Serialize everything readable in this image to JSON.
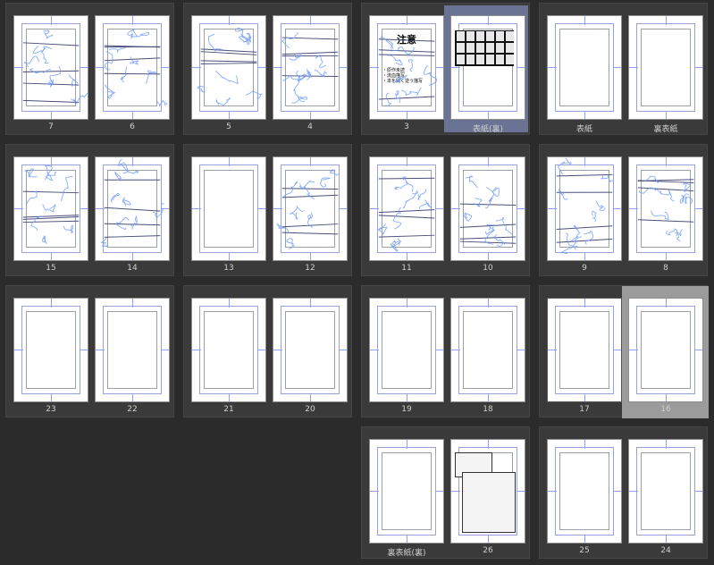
{
  "spreads": [
    {
      "id": "s-7-6",
      "left_label": "7",
      "right_label": "6",
      "left_sketch": true,
      "right_sketch": true
    },
    {
      "id": "s-5-4",
      "left_label": "5",
      "right_label": "4",
      "left_sketch": true,
      "right_sketch": true
    },
    {
      "id": "s-3-cover-back",
      "left_label": "3",
      "right_label": "表紙(裏)",
      "left_notice": true,
      "right_thumbs": true,
      "selected": "right"
    },
    {
      "id": "s-cover",
      "left_label": "表紙",
      "right_label": "裏表紙"
    },
    {
      "id": "s-15-14",
      "left_label": "15",
      "right_label": "14",
      "left_sketch": true,
      "right_sketch": true
    },
    {
      "id": "s-13-12",
      "left_label": "13",
      "right_label": "12",
      "right_sketch": true
    },
    {
      "id": "s-11-10",
      "left_label": "11",
      "right_label": "10",
      "left_sketch": true,
      "right_sketch": true
    },
    {
      "id": "s-9-8",
      "left_label": "9",
      "right_label": "8",
      "left_sketch": true,
      "right_sketch": true
    },
    {
      "id": "s-23-22",
      "left_label": "23",
      "right_label": "22"
    },
    {
      "id": "s-21-20",
      "left_label": "21",
      "right_label": "20"
    },
    {
      "id": "s-19-18",
      "left_label": "19",
      "right_label": "18"
    },
    {
      "id": "s-17-16",
      "left_label": "17",
      "right_label": "16",
      "selected": "right-gray"
    },
    {
      "id": "s-backcover-back-26",
      "left_label": "裏表紙(裏)",
      "right_label": "26",
      "right_art": true
    },
    {
      "id": "s-25-24",
      "left_label": "25",
      "right_label": "24"
    }
  ],
  "notice": {
    "title": "注意",
    "lines": [
      "・原作未読",
      "・流血描写",
      "・本を開く逆う描写"
    ]
  },
  "colors": {
    "sketch": "#6f9bff",
    "panel_bg": "#3a3a3a",
    "app_bg": "#2b2b2b",
    "selected_cover": "#6b7394",
    "selected_16": "#9b9b9b"
  }
}
